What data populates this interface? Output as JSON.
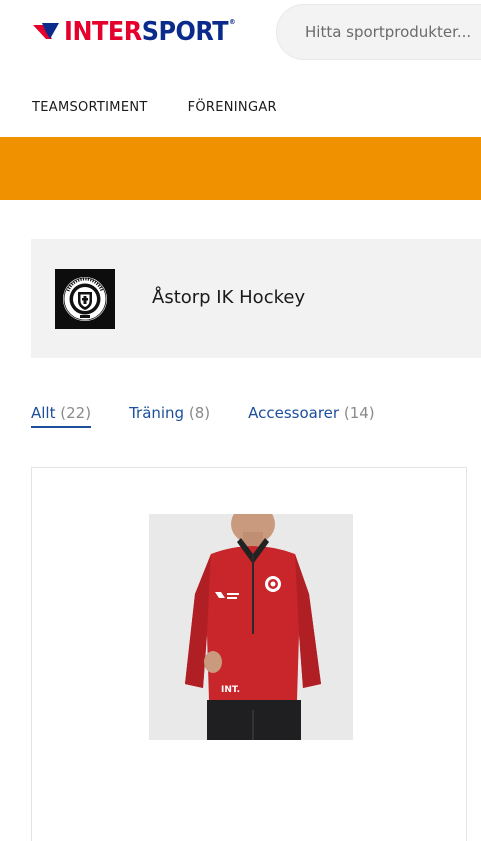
{
  "header": {
    "logo": {
      "text_red": "INTER",
      "text_blue": "SPORT",
      "reg_mark": "®"
    },
    "search": {
      "placeholder": "Hitta sportprodukter..."
    }
  },
  "nav": {
    "items": [
      {
        "label": "TEAMSORTIMENT"
      },
      {
        "label": "FÖRENINGAR"
      }
    ]
  },
  "colors": {
    "brand_red": "#e4002b",
    "brand_blue": "#0a2a8c",
    "banner_orange": "#f09100",
    "link_blue": "#1b4f9c"
  },
  "club": {
    "name": "Åstorp IK Hockey",
    "logo_icon": "club-crest-icon"
  },
  "tabs": [
    {
      "label": "Allt",
      "count": "(22)",
      "active": true
    },
    {
      "label": "Träning",
      "count": "(8)",
      "active": false
    },
    {
      "label": "Accessoarer",
      "count": "(14)",
      "active": false
    }
  ],
  "product": {
    "image_icon": "product-jacket-image",
    "print_text": "INT."
  }
}
